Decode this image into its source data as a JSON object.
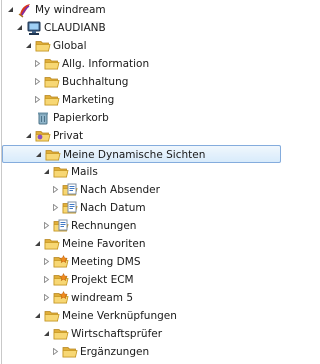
{
  "tree": {
    "items": [
      {
        "id": "my-windream",
        "label": "My windream",
        "level": 0,
        "expanded": true,
        "icon": "windream-logo-icon",
        "selected": false,
        "hasChildren": true
      },
      {
        "id": "claudianb",
        "label": "CLAUDIANB",
        "level": 1,
        "expanded": true,
        "icon": "server-icon",
        "selected": false,
        "hasChildren": true
      },
      {
        "id": "global",
        "label": "Global",
        "level": 2,
        "expanded": true,
        "icon": "folder-icon",
        "selected": false,
        "hasChildren": true
      },
      {
        "id": "allg-information",
        "label": "Allg. Information",
        "level": 3,
        "expanded": false,
        "icon": "folder-icon",
        "selected": false,
        "hasChildren": true
      },
      {
        "id": "buchhaltung",
        "label": "Buchhaltung",
        "level": 3,
        "expanded": false,
        "icon": "folder-icon",
        "selected": false,
        "hasChildren": true
      },
      {
        "id": "marketing",
        "label": "Marketing",
        "level": 3,
        "expanded": false,
        "icon": "folder-icon",
        "selected": false,
        "hasChildren": true
      },
      {
        "id": "papierkorb",
        "label": "Papierkorb",
        "level": 2,
        "expanded": false,
        "icon": "recycle-bin-icon",
        "selected": false,
        "hasChildren": false
      },
      {
        "id": "privat",
        "label": "Privat",
        "level": 2,
        "expanded": true,
        "icon": "private-folder-icon",
        "selected": false,
        "hasChildren": true
      },
      {
        "id": "meine-dynamische-sichten",
        "label": "Meine Dynamische Sichten",
        "level": 3,
        "expanded": true,
        "icon": "folder-icon",
        "selected": true,
        "hasChildren": true
      },
      {
        "id": "mails",
        "label": "Mails",
        "level": 4,
        "expanded": true,
        "icon": "folder-icon",
        "selected": false,
        "hasChildren": true
      },
      {
        "id": "nach-absender",
        "label": "Nach Absender",
        "level": 5,
        "expanded": false,
        "icon": "dynamic-view-icon",
        "selected": false,
        "hasChildren": true
      },
      {
        "id": "nach-datum",
        "label": "Nach Datum",
        "level": 5,
        "expanded": false,
        "icon": "dynamic-view-icon",
        "selected": false,
        "hasChildren": true
      },
      {
        "id": "rechnungen",
        "label": "Rechnungen",
        "level": 4,
        "expanded": false,
        "icon": "dynamic-view-icon",
        "selected": false,
        "hasChildren": true
      },
      {
        "id": "meine-favoriten",
        "label": "Meine Favoriten",
        "level": 3,
        "expanded": true,
        "icon": "folder-icon",
        "selected": false,
        "hasChildren": true
      },
      {
        "id": "meeting-dms",
        "label": "Meeting DMS",
        "level": 4,
        "expanded": false,
        "icon": "favorite-folder-icon",
        "selected": false,
        "hasChildren": true
      },
      {
        "id": "projekt-ecm",
        "label": "Projekt ECM",
        "level": 4,
        "expanded": false,
        "icon": "favorite-folder-icon",
        "selected": false,
        "hasChildren": true
      },
      {
        "id": "windream-5",
        "label": "windream 5",
        "level": 4,
        "expanded": false,
        "icon": "favorite-folder-icon",
        "selected": false,
        "hasChildren": true
      },
      {
        "id": "meine-verknuepfungen",
        "label": "Meine Verknüpfungen",
        "level": 3,
        "expanded": true,
        "icon": "folder-icon",
        "selected": false,
        "hasChildren": true
      },
      {
        "id": "wirtschaftspruefer",
        "label": "Wirtschaftsprüfer",
        "level": 4,
        "expanded": true,
        "icon": "folder-icon",
        "selected": false,
        "hasChildren": true
      },
      {
        "id": "ergaenzungen",
        "label": "Ergänzungen",
        "level": 5,
        "expanded": false,
        "icon": "folder-icon",
        "selected": false,
        "hasChildren": true
      }
    ]
  }
}
